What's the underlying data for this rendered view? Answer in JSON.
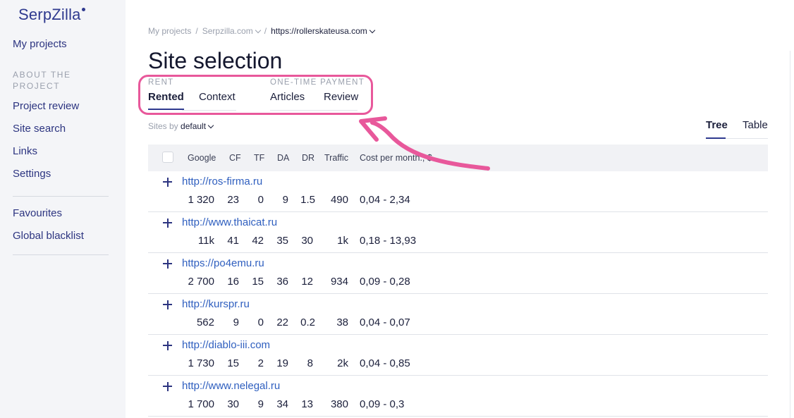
{
  "sidebar": {
    "logo": "SerpZilla",
    "my_projects": "My projects",
    "section_label": "ABOUT THE PROJECT",
    "project_review": "Project review",
    "site_search": "Site search",
    "links": "Links",
    "settings": "Settings",
    "favourites": "Favourites",
    "global_blacklist": "Global blacklist"
  },
  "breadcrumb": {
    "root": "My projects",
    "sep": "/",
    "project": "Serpzilla.com",
    "current": "https://rollerskateusa.com"
  },
  "page_title": "Site selection",
  "tabs": {
    "rent_label": "RENT",
    "rented": "Rented",
    "context": "Context",
    "one_time_label": "ONE-TIME PAYMENT",
    "articles": "Articles",
    "review": "Review"
  },
  "sort": {
    "prefix": "Sites by",
    "value": "default"
  },
  "view": {
    "tree": "Tree",
    "table": "Table"
  },
  "table": {
    "headers": [
      "Google",
      "CF",
      "TF",
      "DA",
      "DR",
      "Traffic",
      "Cost per month., $"
    ],
    "rows": [
      {
        "url": "http://ros-firma.ru",
        "google": "1 320",
        "cf": "23",
        "tf": "0",
        "da": "9",
        "dr": "1.5",
        "traffic": "490",
        "cost": "0,04 - 2,34"
      },
      {
        "url": "http://www.thaicat.ru",
        "google": "11k",
        "cf": "41",
        "tf": "42",
        "da": "35",
        "dr": "30",
        "traffic": "1k",
        "cost": "0,18 - 13,93"
      },
      {
        "url": "https://po4emu.ru",
        "google": "2 700",
        "cf": "16",
        "tf": "15",
        "da": "36",
        "dr": "12",
        "traffic": "934",
        "cost": "0,09 - 0,28"
      },
      {
        "url": "http://kurspr.ru",
        "google": "562",
        "cf": "9",
        "tf": "0",
        "da": "22",
        "dr": "0.2",
        "traffic": "38",
        "cost": "0,04 - 0,07"
      },
      {
        "url": "http://diablo-iii.com",
        "google": "1 730",
        "cf": "15",
        "tf": "2",
        "da": "19",
        "dr": "8",
        "traffic": "2k",
        "cost": "0,04 - 0,85"
      },
      {
        "url": "http://www.nelegal.ru",
        "google": "1 700",
        "cf": "30",
        "tf": "9",
        "da": "34",
        "dr": "13",
        "traffic": "380",
        "cost": "0,09 - 0,3"
      }
    ]
  },
  "colors": {
    "accent": "#2f3a8f",
    "highlight": "#e8589b",
    "link": "#2f5fbf"
  }
}
